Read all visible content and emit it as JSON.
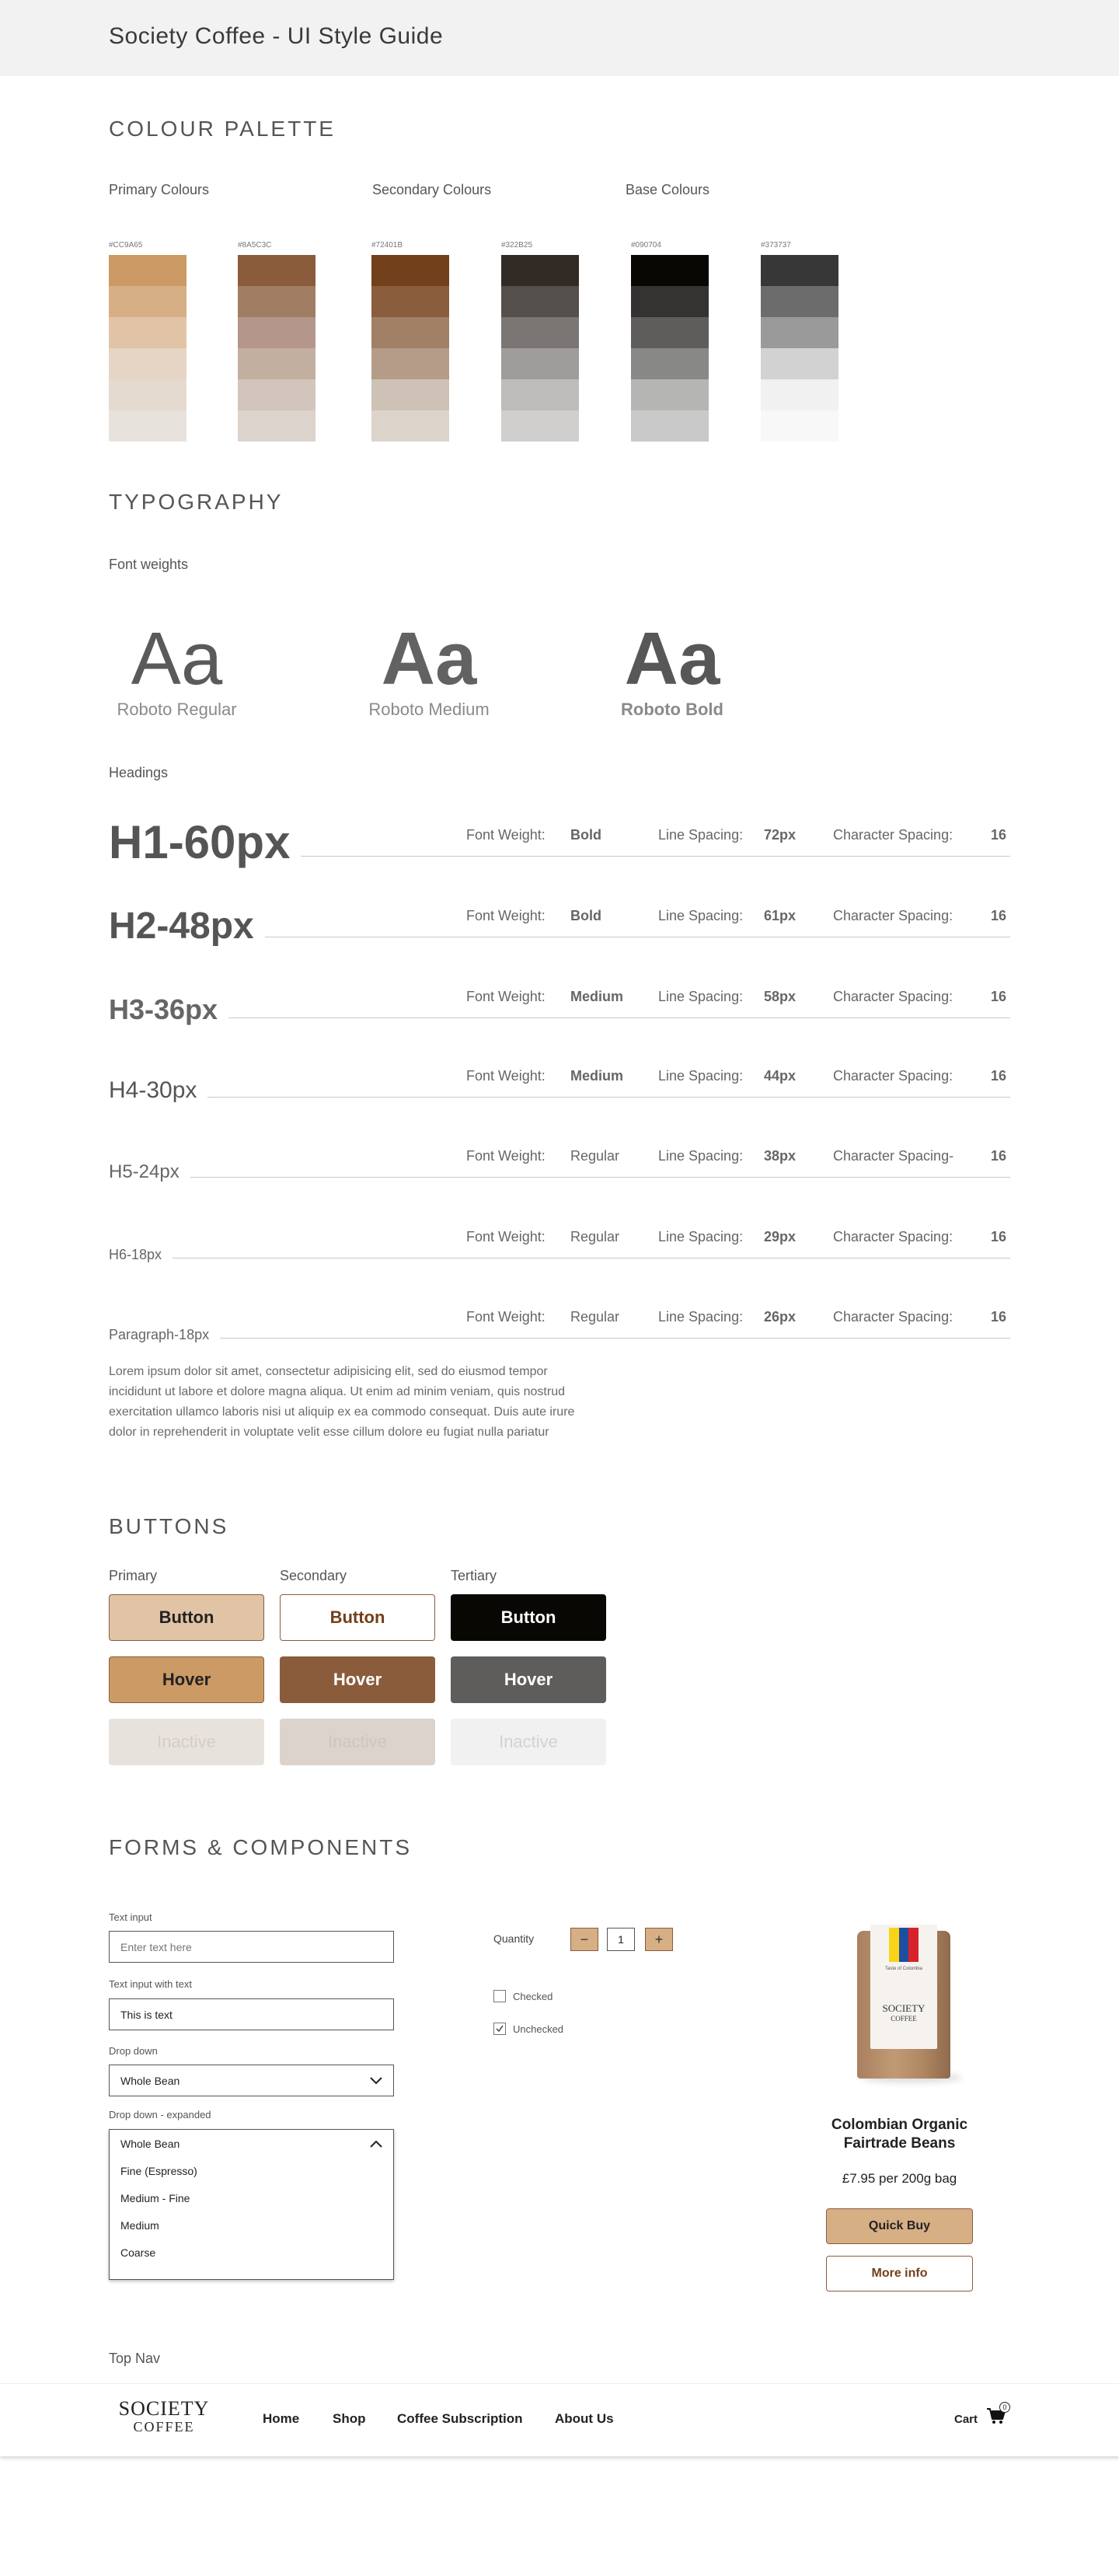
{
  "header": {
    "title": "Society Coffee - UI Style Guide"
  },
  "colour_palette": {
    "title": "COLOUR PALETTE",
    "groups": [
      "Primary Colours",
      "Secondary Colours",
      "Base Colours"
    ],
    "columns": [
      {
        "hex": "#CC9A65",
        "shades": [
          "#CC9A65",
          "#D7AF85",
          "#E1C4A5",
          "#E6D5C4",
          "#E4DAD0",
          "#E8E2DD"
        ]
      },
      {
        "hex": "#8A5C3C",
        "shades": [
          "#8A5C3C",
          "#A17D63",
          "#B4978A",
          "#C3AF9F",
          "#D2C5BD",
          "#DDD3CD"
        ]
      },
      {
        "hex": "#72401B",
        "shades": [
          "#72401B",
          "#8A5E3D",
          "#A18066",
          "#B49C88",
          "#CEC2B7",
          "#DCD3CB"
        ]
      },
      {
        "hex": "#322B25",
        "shades": [
          "#322B25",
          "#55504C",
          "#7A7674",
          "#9F9D9B",
          "#BEBDBB",
          "#D0CFCE"
        ]
      },
      {
        "hex": "#090704",
        "shades": [
          "#090704",
          "#353331",
          "#5E5D5B",
          "#888887",
          "#B5B5B4",
          "#C9C9C9"
        ]
      },
      {
        "hex": "#373737",
        "shades": [
          "#373737",
          "#6C6C6C",
          "#9A9A9A",
          "#D2D2D2",
          "#F1F1F1",
          "#F8F8F8"
        ]
      }
    ]
  },
  "typography": {
    "title": "TYPOGRAPHY",
    "font_weights_label": "Font weights",
    "samples": [
      {
        "glyph": "Aa",
        "name": "Roboto Regular"
      },
      {
        "glyph": "Aa",
        "name": "Roboto Medium"
      },
      {
        "glyph": "Aa",
        "name": "Roboto Bold"
      }
    ],
    "headings_label": "Headings",
    "fw_label": "Font Weight:",
    "ls_label": "Line Spacing:",
    "cs_label": "Character Spacing:",
    "cs_label_h5": "Character Spacing-",
    "rows": [
      {
        "name": "H1-60px",
        "weight": "Bold",
        "line": "72px",
        "char": "16"
      },
      {
        "name": "H2-48px",
        "weight": "Bold",
        "line": "61px",
        "char": "16"
      },
      {
        "name": "H3-36px",
        "weight": "Medium",
        "line": "58px",
        "char": "16"
      },
      {
        "name": "H4-30px",
        "weight": "Medium",
        "line": "44px",
        "char": "16"
      },
      {
        "name": "H5-24px",
        "weight": "Regular",
        "line": "38px",
        "char": "16"
      },
      {
        "name": "H6-18px",
        "weight": "Regular",
        "line": "29px",
        "char": "16"
      },
      {
        "name": "Paragraph-18px",
        "weight": "Regular",
        "line": "26px",
        "char": "16"
      }
    ],
    "lorem": "Lorem ipsum dolor sit amet, consectetur adipisicing elit, sed do eiusmod tempor incididunt ut labore et dolore magna aliqua. Ut enim ad minim veniam, quis nostrud exercitation ullamco laboris nisi ut aliquip ex ea commodo consequat. Duis aute irure dolor in reprehenderit in voluptate velit esse cillum dolore eu fugiat nulla pariatur"
  },
  "buttons": {
    "title": "BUTTONS",
    "col_labels": [
      "Primary",
      "Secondary",
      "Tertiary"
    ],
    "default_label": "Button",
    "hover_label": "Hover",
    "inactive_label": "Inactive"
  },
  "forms": {
    "title": "FORMS & COMPONENTS",
    "text_input_label": "Text input",
    "text_input_placeholder": "Enter text here",
    "text_input_with_text_label": "Text input with text",
    "text_input_value": "This is text",
    "dropdown_label": "Drop down",
    "dropdown_value": "Whole Bean",
    "dropdown_expanded_label": "Drop down - expanded",
    "dropdown_expanded_value": "Whole Bean",
    "dropdown_options": [
      "Fine (Espresso)",
      "Medium - Fine",
      "Medium",
      "Coarse"
    ],
    "quantity_label": "Quantity",
    "quantity_minus": "−",
    "quantity_value": "1",
    "quantity_plus": "+",
    "checked_label": "Checked",
    "unchecked_label": "Unchecked",
    "product": {
      "bag_tag": "Taste of Colombia",
      "bag_brand": "SOCIETY",
      "bag_brand_sub": "COFFEE",
      "name": "Colombian Organic Fairtrade Beans",
      "price": "£7.95 per 200g bag",
      "primary_button": "Quick Buy",
      "secondary_button": "More info"
    }
  },
  "top_nav": {
    "section_label": "Top Nav",
    "logo_line1": "SOCIETY",
    "logo_line2": "COFFEE",
    "links": [
      "Home",
      "Shop",
      "Coffee Subscription",
      "About Us"
    ],
    "cart_label": "Cart",
    "cart_count": "0"
  },
  "colors": {
    "primary": "#CC9A65",
    "primary_light": "#E1C4A5",
    "secondary": "#8A5C3C",
    "dark": "#090704",
    "text": "#575757"
  }
}
